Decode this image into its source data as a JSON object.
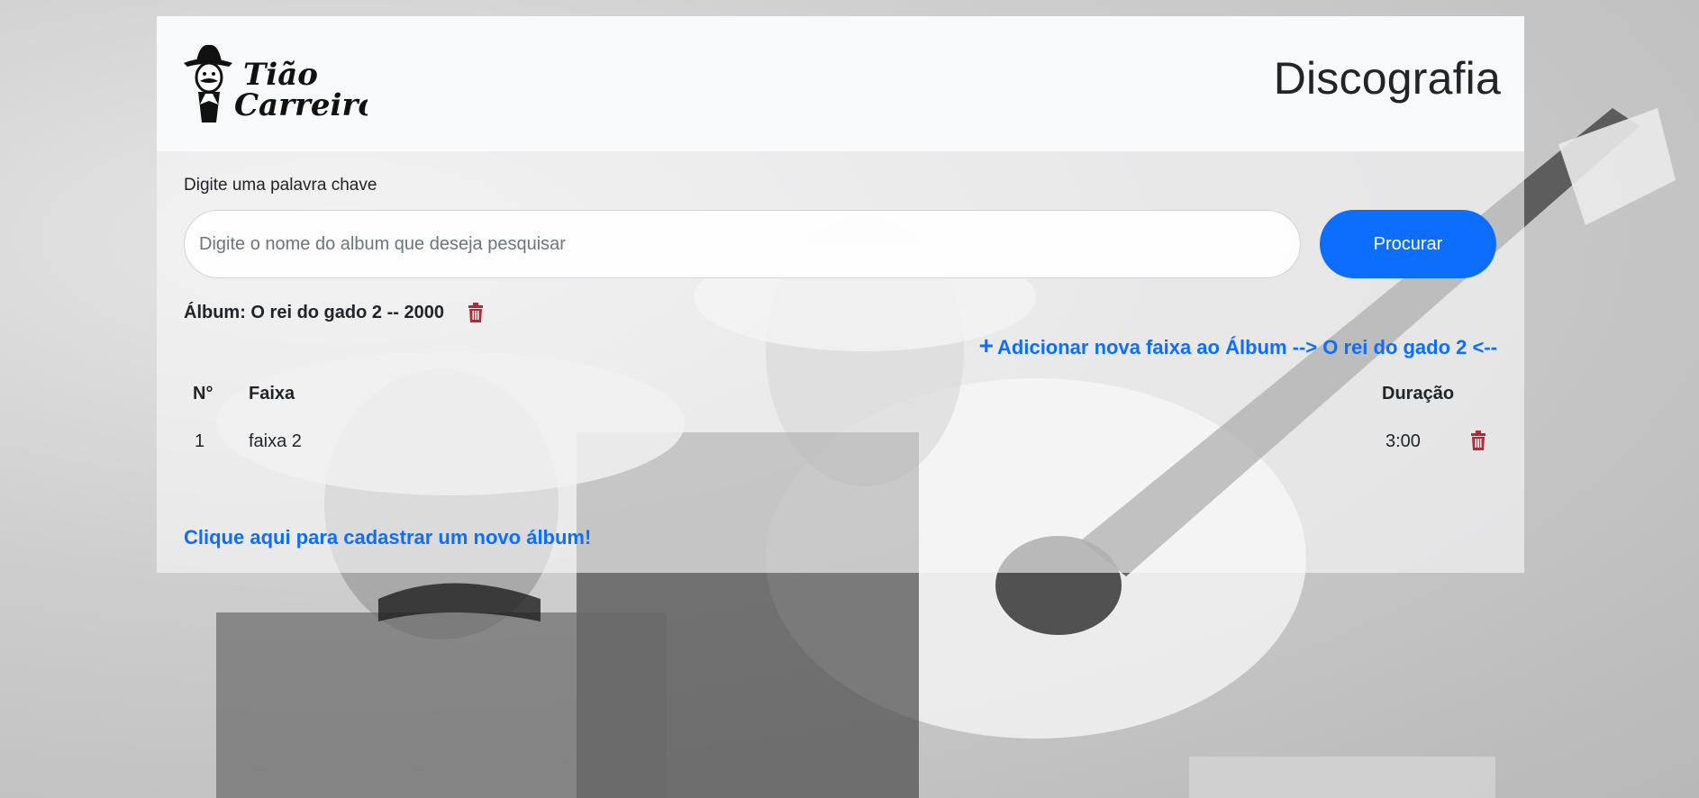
{
  "header": {
    "logo_text_line1": "Tião",
    "logo_text_line2": "Carreiro",
    "title": "Discografia"
  },
  "search": {
    "label": "Digite uma palavra chave",
    "placeholder": "Digite o nome do album que deseja pesquisar",
    "value": "",
    "button_label": "Procurar"
  },
  "album": {
    "title": "Álbum: O rei do gado 2 -- 2000",
    "add_track_label": "Adicionar nova faixa ao Álbum --> O rei do gado 2 <--",
    "table": {
      "headers": [
        "N°",
        "Faixa",
        "Duração"
      ],
      "rows": [
        {
          "number": "1",
          "track": "faixa 2",
          "duration": "3:00"
        }
      ]
    }
  },
  "footer_link": "Clique aqui para cadastrar um novo álbum!",
  "colors": {
    "primary": "#0d6efd",
    "danger": "#b02a37",
    "text": "#212529"
  },
  "icons": {
    "delete": "trash-icon",
    "add": "plus-icon"
  }
}
